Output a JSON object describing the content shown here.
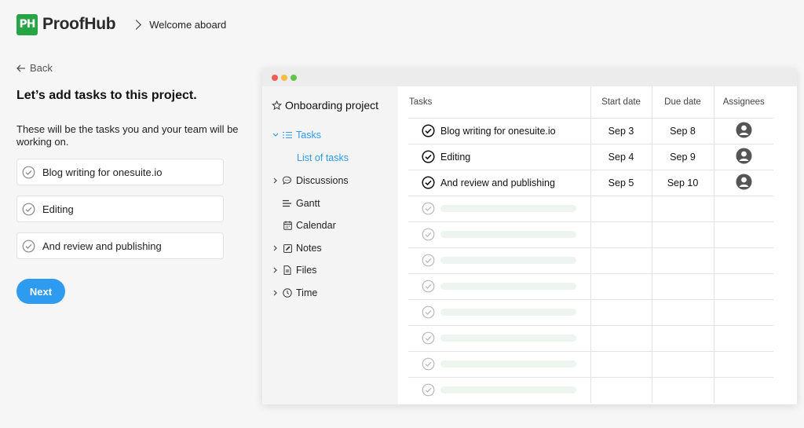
{
  "header": {
    "logo_mark": "PH",
    "logo_text": "ProofHub",
    "breadcrumb": "Welcome aboard",
    "brand_color": "#27a444"
  },
  "onboarding": {
    "back_label": "Back",
    "title": "Let’s add tasks to this project.",
    "description": "These will be the tasks you and your team will be working on.",
    "tasks": [
      "Blog writing for onesuite.io",
      "Editing",
      "And review and publishing"
    ],
    "next_label": "Next",
    "accent_color": "#2e9af0"
  },
  "preview": {
    "window_dots": [
      "#ee5d55",
      "#f4bd3c",
      "#5fc54a"
    ],
    "project_name": "Onboarding project",
    "nav": {
      "tasks": "Tasks",
      "list_of_tasks": "List of tasks",
      "discussions": "Discussions",
      "gantt": "Gantt",
      "calendar": "Calendar",
      "notes": "Notes",
      "files": "Files",
      "time": "Time"
    },
    "columns": {
      "tasks": "Tasks",
      "start_date": "Start date",
      "due_date": "Due date",
      "assignees": "Assignees"
    },
    "rows": [
      {
        "name": "Blog writing for onesuite.io",
        "start": "Sep 3",
        "due": "Sep 8"
      },
      {
        "name": "Editing",
        "start": "Sep 4",
        "due": "Sep 9"
      },
      {
        "name": "And review and publishing",
        "start": "Sep 5",
        "due": "Sep 10"
      }
    ],
    "placeholder_rows": 8
  }
}
